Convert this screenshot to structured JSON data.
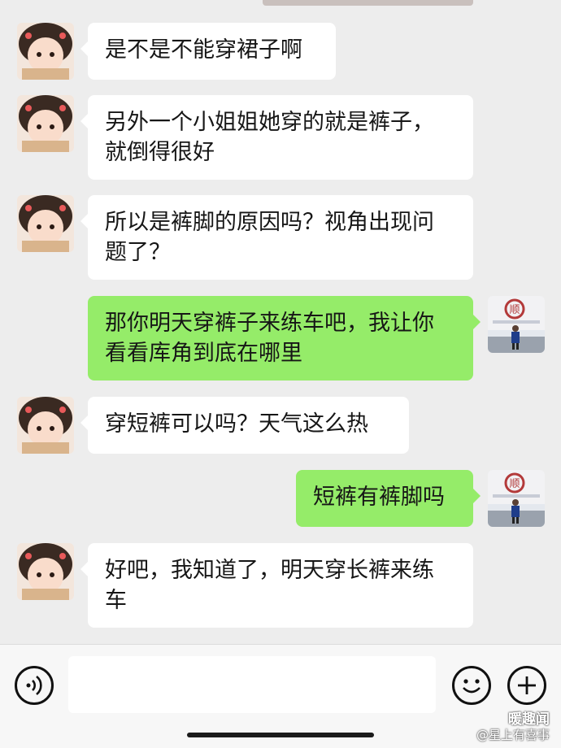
{
  "messages": [
    {
      "side": "left",
      "text": "是不是不能穿裙子啊"
    },
    {
      "side": "left",
      "text": "另外一个小姐姐她穿的就是裤子，\n就倒得很好"
    },
    {
      "side": "left",
      "text": "所以是裤脚的原因吗？视角出现问\n题了？"
    },
    {
      "side": "right",
      "text": "那你明天穿裤子来练车吧，我让你\n看看库角到底在哪里"
    },
    {
      "side": "left",
      "text": "穿短裤可以吗？天气这么热"
    },
    {
      "side": "right",
      "text": "短裤有裤脚吗"
    },
    {
      "side": "left",
      "text": "好吧，我知道了，明天穿长裤来练\n车"
    }
  ],
  "input_bar": {
    "voice_icon": "voice-icon",
    "emoji_icon": "emoji-icon",
    "plus_icon": "plus-icon",
    "placeholder": ""
  },
  "watermark": {
    "line1": "暖趣闻",
    "line2": "@星上有喜事"
  },
  "colors": {
    "background": "#ededed",
    "bubble_left": "#ffffff",
    "bubble_right": "#95ec69",
    "input_bar": "#f7f7f7"
  }
}
